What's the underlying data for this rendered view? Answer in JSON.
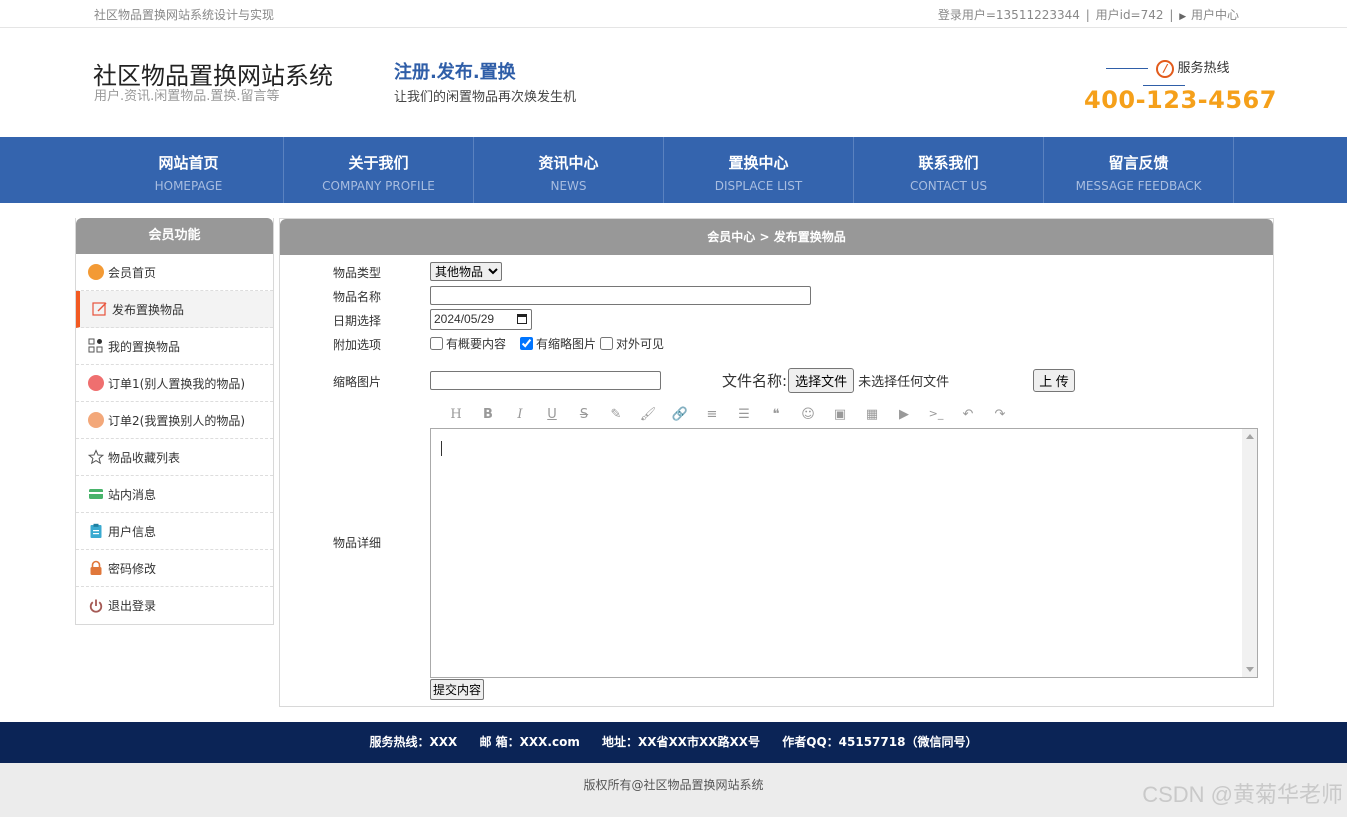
{
  "topbar": {
    "site_name": "社区物品置换网站系统设计与实现",
    "login_user": "登录用户=13511223344",
    "user_id": "用户id=742",
    "sep": "|",
    "user_center": "用户中心"
  },
  "header": {
    "title": "社区物品置换网站系统",
    "subtitle": "用户.资讯.闲置物品.置换.留言等",
    "slogan_title": "注册.发布.置换",
    "slogan_sub": "让我们的闲置物品再次焕发生机",
    "hotline_label": "服务热线",
    "hotline_number": "400-123-4567"
  },
  "nav": [
    {
      "cn": "网站首页",
      "en": "HOMEPAGE"
    },
    {
      "cn": "关于我们",
      "en": "COMPANY PROFILE"
    },
    {
      "cn": "资讯中心",
      "en": "NEWS"
    },
    {
      "cn": "置换中心",
      "en": "DISPLACE LIST"
    },
    {
      "cn": "联系我们",
      "en": "CONTACT US"
    },
    {
      "cn": "留言反馈",
      "en": "MESSAGE FEEDBACK"
    }
  ],
  "sidebar": {
    "title": "会员功能",
    "items": [
      {
        "label": "会员首页",
        "icon": "home-icon",
        "color": "#f39a35"
      },
      {
        "label": "发布置换物品",
        "icon": "edit-icon",
        "color": "#e8533a"
      },
      {
        "label": "我的置换物品",
        "icon": "grid-icon",
        "color": "#555555"
      },
      {
        "label": "订单1(别人置换我的物品)",
        "icon": "order-icon",
        "color": "#ef6f6f"
      },
      {
        "label": "订单2(我置换别人的物品)",
        "icon": "order-icon",
        "color": "#f3a87a"
      },
      {
        "label": "物品收藏列表",
        "icon": "star-icon",
        "color": "#555555"
      },
      {
        "label": "站内消息",
        "icon": "card-icon",
        "color": "#48b36a"
      },
      {
        "label": "用户信息",
        "icon": "clipboard-icon",
        "color": "#3aaad0"
      },
      {
        "label": "密码修改",
        "icon": "lock-icon",
        "color": "#e0773a"
      },
      {
        "label": "退出登录",
        "icon": "power-icon",
        "color": "#a55a55"
      }
    ]
  },
  "main": {
    "breadcrumb": "会员中心 > 发布置换物品",
    "form": {
      "type_label": "物品类型",
      "type_value": "其他物品",
      "name_label": "物品名称",
      "name_value": "",
      "date_label": "日期选择",
      "date_value": "2024/05/29",
      "extra_label": "附加选项",
      "opt1": "有概要内容",
      "opt2": "有缩略图片",
      "opt3": "对外可见",
      "thumb_label": "缩略图片",
      "file_name_label": "文件名称:",
      "choose_file": "选择文件",
      "no_file": "未选择任何文件",
      "upload": "上 传",
      "detail_label": "物品详细",
      "submit": "提交内容"
    },
    "toolbar": [
      "H",
      "B",
      "I",
      "U",
      "S",
      "✎",
      "🖌",
      "🔗",
      "≡",
      "☰",
      "❝",
      "☺",
      "▣",
      "▦",
      "▶",
      ">_",
      "↶",
      "↷"
    ]
  },
  "footer": {
    "hotline": "服务热线：XXX",
    "email": "邮 箱：XXX.com",
    "address": "地址：XX省XX市XX路XX号",
    "qq": "作者QQ：45157718（微信同号）",
    "copyright": "版权所有@社区物品置换网站系统",
    "watermark": "CSDN @黄菊华老师"
  }
}
